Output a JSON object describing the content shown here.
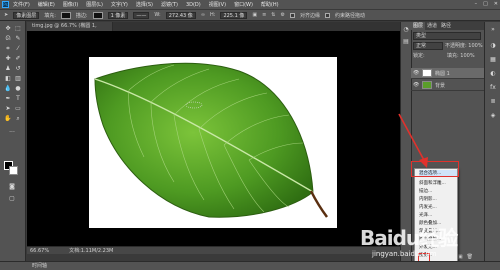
{
  "app": {
    "logo": "Ps"
  },
  "menubar": {
    "items": [
      "文件(F)",
      "编辑(E)",
      "图像(I)",
      "图层(L)",
      "文字(Y)",
      "选择(S)",
      "滤镜(T)",
      "3D(D)",
      "视图(V)",
      "窗口(W)",
      "帮助(H)"
    ]
  },
  "optionsbar": {
    "mode_label": "像素图层",
    "fill_label": "填充:",
    "stroke_label": "描边:",
    "stroke_width": "1 像素",
    "w_label": "W:",
    "w_value": "272.43 像",
    "h_label": "H:",
    "h_value": "225.1 像",
    "align_edges_label": "对齐边缘",
    "constrain_label": "约束路径拖动"
  },
  "document": {
    "tab_title": "timg.jpg @ 66.7% (椭圆 1, RGB/8#) *",
    "zoom": "66.67%",
    "doc_info": "文档:1.11M/2.23M"
  },
  "panels": {
    "tabs": [
      "图层",
      "通道",
      "路径"
    ],
    "blend_mode": "正常",
    "opacity_label": "不透明度: 100%",
    "lock_label": "锁定:",
    "fill_label": "填充: 100%",
    "kind_label": "类型",
    "layers": [
      {
        "name": "椭圆 1"
      },
      {
        "name": "背景"
      }
    ]
  },
  "context_menu": {
    "items": [
      "混合选项...",
      "斜面和浮雕...",
      "描边...",
      "内阴影...",
      "内发光...",
      "光泽...",
      "颜色叠加...",
      "渐变叠加...",
      "图案叠加...",
      "外发光...",
      "投影..."
    ]
  },
  "timeline": {
    "label": "时间轴"
  },
  "watermark": {
    "brand": "Baidu经验",
    "url": "jingyan.baidu.com"
  }
}
